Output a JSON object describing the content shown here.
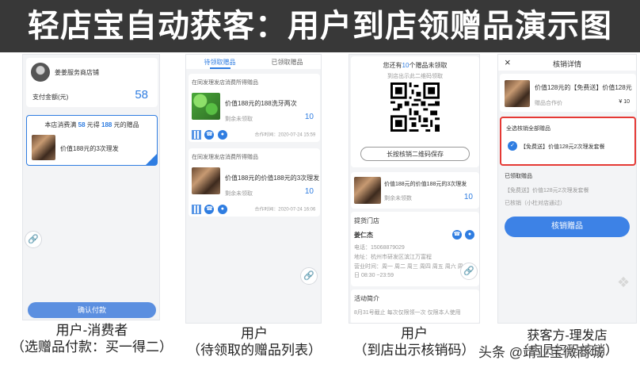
{
  "banner": {
    "title": "轻店宝自动获客：用户到店领赠品演示图"
  },
  "phone1": {
    "shop_name": "姜姜服务商店铺",
    "pay_label": "支付金额(元)",
    "pay_amount": "58",
    "offer_prefix": "本店消费满",
    "offer_amount": "58",
    "offer_middle": "元得",
    "offer_gift_count": "188",
    "offer_suffix": "元的赠品",
    "gift_title": "价值188元的3次理发",
    "confirm_label": "确认付款"
  },
  "phone2": {
    "tabs": [
      {
        "label": "待领取赠品"
      },
      {
        "label": "已领取赠品"
      }
    ],
    "items": [
      {
        "header": "在同发理发店消费所得赠品",
        "title": "价值188元的188洗牙两次",
        "remain_label": "剩余未领取",
        "remain": "10",
        "partner": "合作时间：2020-07-24 15:59"
      },
      {
        "header": "在同发理发店消费所得赠品",
        "title": "价值188元的价值188元的3次理发",
        "remain_label": "剩余未领取",
        "remain": "10",
        "partner": "合作时间：2020-07-24 16:06"
      }
    ]
  },
  "phone3": {
    "unclaimed_prefix": "您还有",
    "unclaimed_count": "10",
    "unclaimed_suffix": "个赠品未领取",
    "hint": "到店出示此二维码领取",
    "save_label": "长按核销二维码保存",
    "gift_title": "价值188元的价值188元的3次理发",
    "gift_remain": "剩余未领数",
    "gift_count": "10",
    "store_section": "提货门店",
    "store_name": "姜仁杰",
    "phone": "电话：15068879029",
    "address": "地址：杭州市研发区滨江万富程",
    "hours": "营业时间：周一 周二 周三 周四 周五 周六 周日 08:30 ~23:59",
    "activity_section": "活动简介",
    "activity_text": "8月31号截止 每次仅限领一次 仅限本人使用"
  },
  "phone4": {
    "header_title": "核销详情",
    "close_icon_label": "×",
    "gift_title": "价值128元的【免费送】价值128元",
    "gift_sub": "赠品合作价",
    "gift_price": "¥ 10",
    "select_all_label": "全选核销全部赠品",
    "selected_item": "【免费送】价值128元2次理发套餐",
    "claimed_section": "已领取赠品",
    "claimed_item": "【免费送】价值128元2次理发套餐",
    "claimed_count": "已核销（小杜对店通过）",
    "verify_button": "核销赠品"
  },
  "captions": {
    "c1_line1": "用户-消费者",
    "c1_line2": "（选赠品付款：买一得二）",
    "c2_line1": "用户",
    "c2_line2": "（待领取的赠品列表）",
    "c3_line1": "用户",
    "c3_line2": "（到店出示核销码）",
    "c4_line1": "获客方-理发店",
    "c4_line2": "（店员扫码核销）"
  },
  "watermark": "头条 @靖业宝微商城",
  "colors": {
    "accent": "#2f7de1",
    "banner_bg": "#383838",
    "highlight_border": "#e53935"
  }
}
